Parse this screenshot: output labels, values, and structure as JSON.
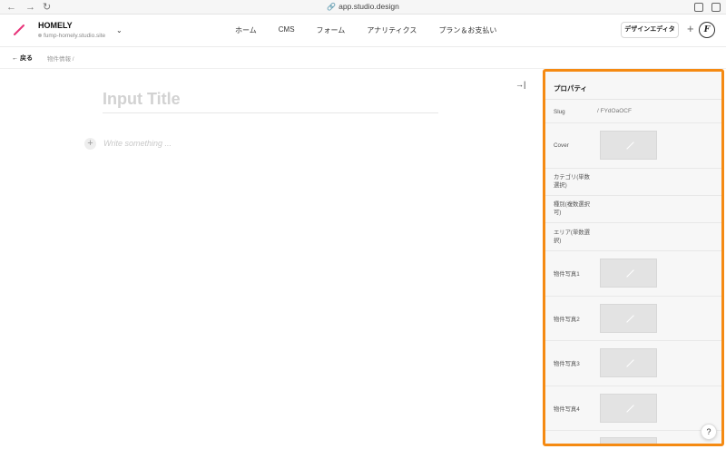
{
  "browser": {
    "url": "app.studio.design",
    "back_glyph": "←",
    "forward_glyph": "→",
    "reload_glyph": "↻"
  },
  "header": {
    "site_name": "HOMELY",
    "site_url": "fump-homely.studio.site",
    "chevron": "⌄",
    "nav": [
      "ホーム",
      "CMS",
      "フォーム",
      "アナリティクス",
      "プラン＆お支払い"
    ],
    "design_editor_label": "デザインエディタ",
    "plus_glyph": "+",
    "avatar_letter": "F",
    "accent": "#e8347a"
  },
  "breadcrumb": {
    "back_label": "戻る",
    "path": "物件情報  /"
  },
  "editor": {
    "title_placeholder": "Input Title",
    "body_placeholder": "Write something ...",
    "add_glyph": "+",
    "collapse_glyph": "→|"
  },
  "panel": {
    "title": "プロパティ",
    "border_color": "#f58a12",
    "properties": [
      {
        "label": "Slug",
        "value": "/ FYdOaOCF"
      },
      {
        "label": "Cover",
        "value": ""
      },
      {
        "label": "カテゴリ(単数選択)",
        "value": ""
      },
      {
        "label": "種別(複数選択可)",
        "value": ""
      },
      {
        "label": "エリア(単数選択)",
        "value": ""
      },
      {
        "label": "物件写真1",
        "value": ""
      },
      {
        "label": "物件写真2",
        "value": ""
      },
      {
        "label": "物件写真3",
        "value": ""
      },
      {
        "label": "物件写真4",
        "value": ""
      }
    ]
  },
  "help_label": "?"
}
